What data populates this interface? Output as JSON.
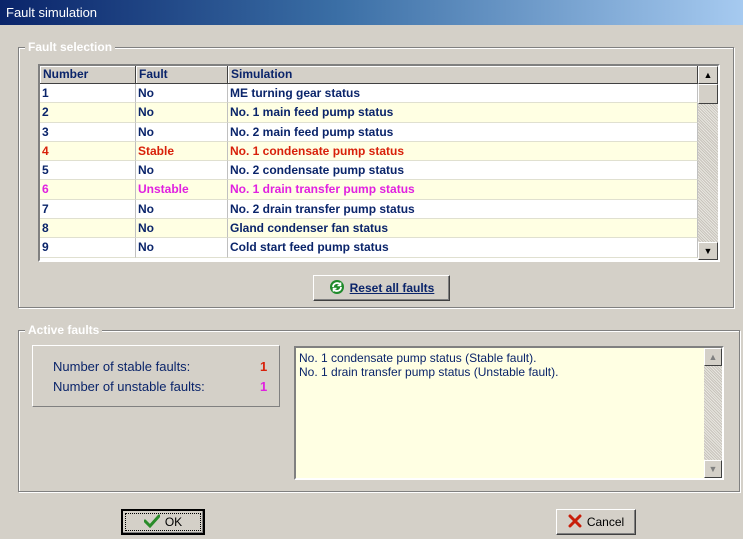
{
  "window": {
    "title": "Fault simulation"
  },
  "fault_selection": {
    "label": "Fault selection",
    "columns": [
      "Number",
      "Fault",
      "Simulation"
    ],
    "rows": [
      {
        "number": "1",
        "fault": "No",
        "simulation": "ME turning gear status",
        "state": "normal"
      },
      {
        "number": "2",
        "fault": "No",
        "simulation": "No. 1 main feed pump status",
        "state": "normal"
      },
      {
        "number": "3",
        "fault": "No",
        "simulation": "No. 2 main feed pump status",
        "state": "normal"
      },
      {
        "number": "4",
        "fault": "Stable",
        "simulation": "No. 1 condensate pump status",
        "state": "stable"
      },
      {
        "number": "5",
        "fault": "No",
        "simulation": "No. 2 condensate pump status",
        "state": "normal"
      },
      {
        "number": "6",
        "fault": "Unstable",
        "simulation": "No. 1 drain transfer pump status",
        "state": "unstable"
      },
      {
        "number": "7",
        "fault": "No",
        "simulation": "No. 2 drain transfer pump status",
        "state": "normal"
      },
      {
        "number": "8",
        "fault": "No",
        "simulation": "Gland condenser fan status",
        "state": "normal"
      },
      {
        "number": "9",
        "fault": "No",
        "simulation": "Cold start feed pump status",
        "state": "normal"
      }
    ],
    "reset_button": {
      "label": "Reset all faults",
      "icon": "refresh-icon"
    }
  },
  "active_faults": {
    "label": "Active faults",
    "stable_label": "Number of stable faults:",
    "stable_count": "1",
    "unstable_label": "Number of unstable faults:",
    "unstable_count": "1",
    "lines": [
      "No. 1 condensate pump status (Stable fault).",
      "No. 1 drain transfer pump status (Unstable fault)."
    ]
  },
  "footer": {
    "ok_label": "OK",
    "ok_icon": "checkmark-icon",
    "cancel_label": "Cancel",
    "cancel_icon": "x-icon"
  },
  "colors": {
    "stable": "#d8200a",
    "unstable": "#e020e0",
    "text_blue": "#0a246a",
    "row_alt": "#ffffe3"
  }
}
